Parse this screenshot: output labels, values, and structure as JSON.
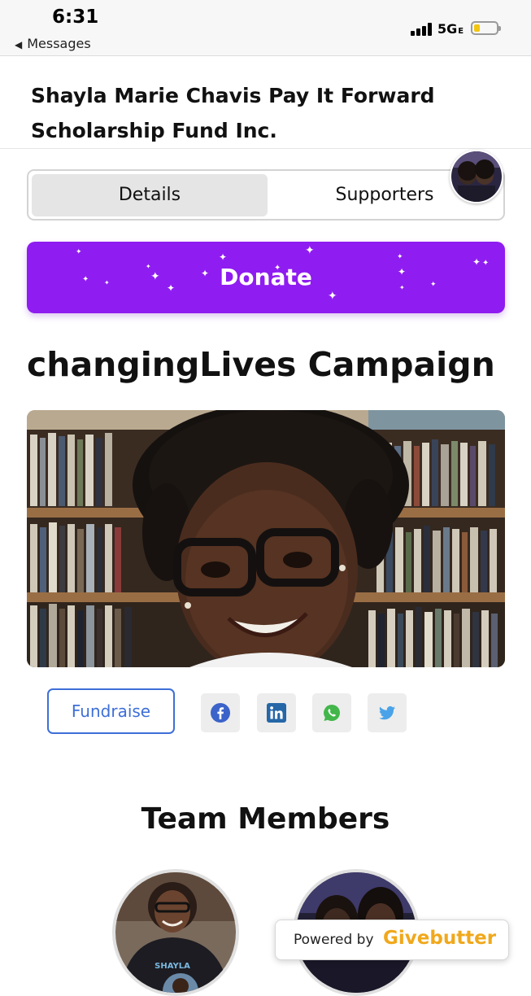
{
  "status_bar": {
    "time": "6:31",
    "back_label": "Messages",
    "network": "5G",
    "network_suffix": "E"
  },
  "organization": {
    "name": "Shayla Marie Chavis Pay It Forward Scholarship Fund Inc."
  },
  "tabs": [
    {
      "label": "Details",
      "active": true
    },
    {
      "label": "Supporters",
      "active": false
    }
  ],
  "donate": {
    "label": "Donate",
    "color": "#8f1cf0"
  },
  "campaign": {
    "title": "changingLives Campaign"
  },
  "actions": {
    "fundraise_label": "Fundraise",
    "accent_color": "#3e6fd8",
    "share_icons": [
      "facebook-icon",
      "linkedin-icon",
      "whatsapp-icon",
      "twitter-icon"
    ]
  },
  "team": {
    "title": "Team Members"
  },
  "powered_by": {
    "prefix": "Powered by",
    "brand": "Givebutter",
    "brand_color": "#f0a81c"
  }
}
